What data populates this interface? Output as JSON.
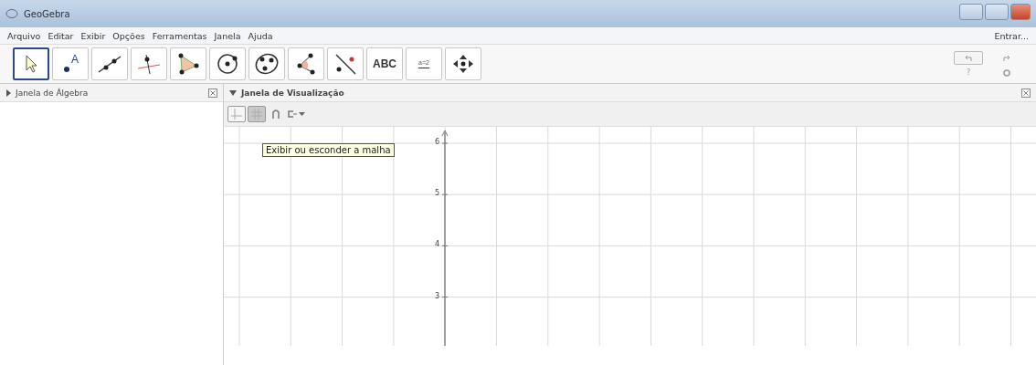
{
  "window": {
    "title": "GeoGebra"
  },
  "menu": {
    "items": [
      "Arquivo",
      "Editar",
      "Exibir",
      "Opções",
      "Ferramentas",
      "Janela",
      "Ajuda"
    ],
    "sign_in": "Entrar..."
  },
  "tools": [
    {
      "kind": "move",
      "selected": true
    },
    {
      "kind": "point",
      "selected": false,
      "label": "A"
    },
    {
      "kind": "line",
      "selected": false
    },
    {
      "kind": "perpendicular",
      "selected": false
    },
    {
      "kind": "polygon",
      "selected": false
    },
    {
      "kind": "circle",
      "selected": false
    },
    {
      "kind": "ellipse",
      "selected": false
    },
    {
      "kind": "angle",
      "selected": false
    },
    {
      "kind": "reflect",
      "selected": false
    },
    {
      "kind": "text",
      "selected": false,
      "label": "ABC"
    },
    {
      "kind": "slider",
      "selected": false,
      "label": "a=2"
    },
    {
      "kind": "pan",
      "selected": false
    }
  ],
  "toolbar_right": {
    "help": "?"
  },
  "algebra_view": {
    "title": "Janela de Álgebra",
    "expanded": false
  },
  "graphics_view": {
    "title": "Janela de Visualização",
    "expanded": true,
    "style_bar": [
      {
        "kind": "axes",
        "selected": false
      },
      {
        "kind": "grid",
        "selected": true
      }
    ],
    "tooltip": "Exibir ou esconder a malha",
    "y_labels": [
      "6",
      "5",
      "4",
      "3"
    ]
  }
}
